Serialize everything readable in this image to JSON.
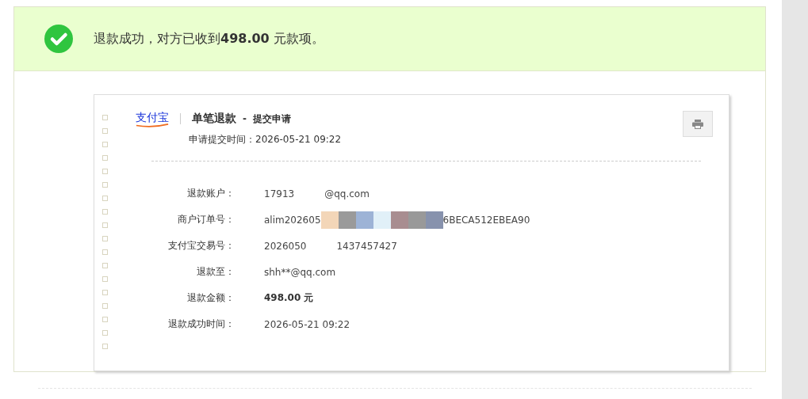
{
  "banner": {
    "message": "退款成功，对方已收到**498.00** 元款项。"
  },
  "receipt": {
    "logo_text": "支付宝",
    "title": "单笔退款",
    "separator": "-",
    "subtitle": "提交申请",
    "submitted_label": "申请提交时间：",
    "submitted_time": "2026-05-21 09:22",
    "fields": [
      {
        "kind": "blanked",
        "label": "退款账户：",
        "before": "17913",
        "after": "@qq.com",
        "bold": false
      },
      {
        "kind": "mosaic",
        "label": "商户订单号：",
        "before": "alim202605",
        "after": "6BECA512EBEA90",
        "bold": false
      },
      {
        "kind": "blanked",
        "label": "支付宝交易号：",
        "before": "2026050",
        "after": "1437457427",
        "bold": false
      },
      {
        "kind": "plain",
        "label": "退款至：",
        "before": "shh**@qq.com",
        "bold": false
      },
      {
        "kind": "plain",
        "label": "退款金额：",
        "before": "498.00 元",
        "bold": true
      },
      {
        "kind": "plain",
        "label": "退款成功时间：",
        "before": "2026-05-21 09:22",
        "bold": false
      }
    ]
  }
}
